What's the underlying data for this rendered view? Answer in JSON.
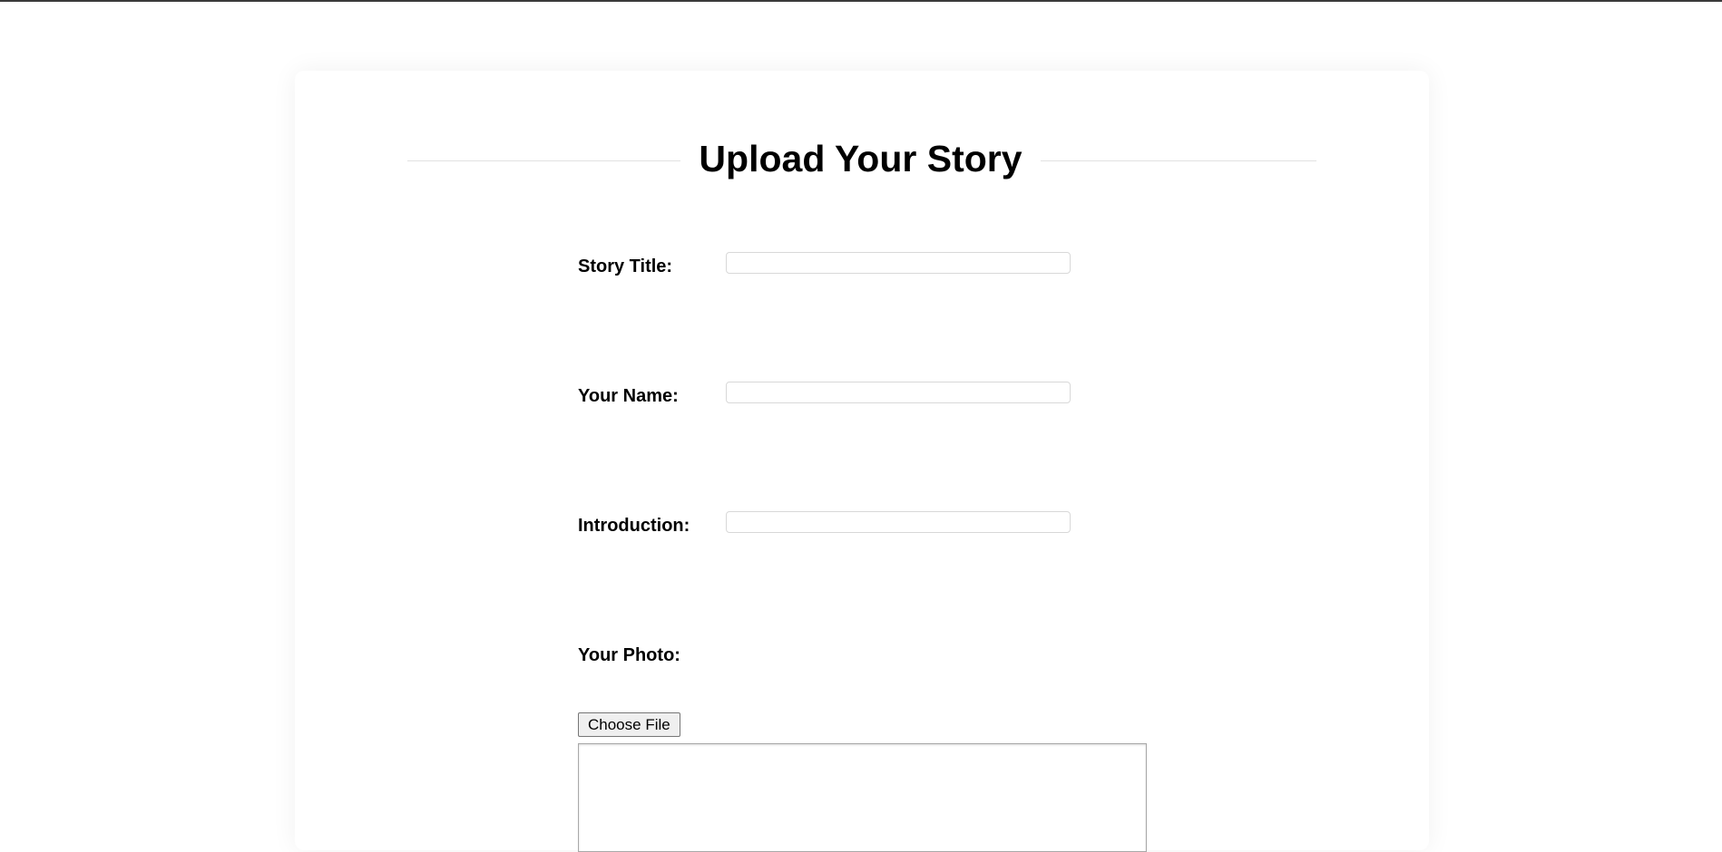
{
  "page": {
    "title": "Upload Your Story"
  },
  "form": {
    "fields": [
      {
        "label": "Story Title:",
        "value": "",
        "placeholder": ""
      },
      {
        "label": "Your Name:",
        "value": "",
        "placeholder": ""
      },
      {
        "label": "Introduction:",
        "value": "",
        "placeholder": ""
      }
    ],
    "photo": {
      "label": "Your Photo:",
      "button_label": "Choose File"
    }
  }
}
